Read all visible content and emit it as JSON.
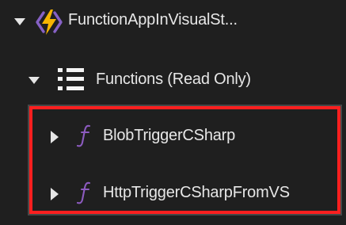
{
  "tree": {
    "app": {
      "label": "FunctionAppInVisualSt...",
      "expanded": true,
      "icon": "function-app-icon"
    },
    "functions_group": {
      "label": "Functions (Read Only)",
      "expanded": true,
      "icon": "list-icon"
    },
    "functions": [
      {
        "label": "BlobTriggerCSharp",
        "icon": "function-icon",
        "expanded": false
      },
      {
        "label": "HttpTriggerCSharpFromVS",
        "icon": "function-icon",
        "expanded": false
      }
    ]
  },
  "colors": {
    "background": "#1f1f1f",
    "text": "#e7e7e7",
    "function_app_yellow": "#f7b500",
    "function_app_purple": "#8661c5",
    "function_icon_purple": "#8c5bbf",
    "highlight_red": "#ff1f1f"
  }
}
